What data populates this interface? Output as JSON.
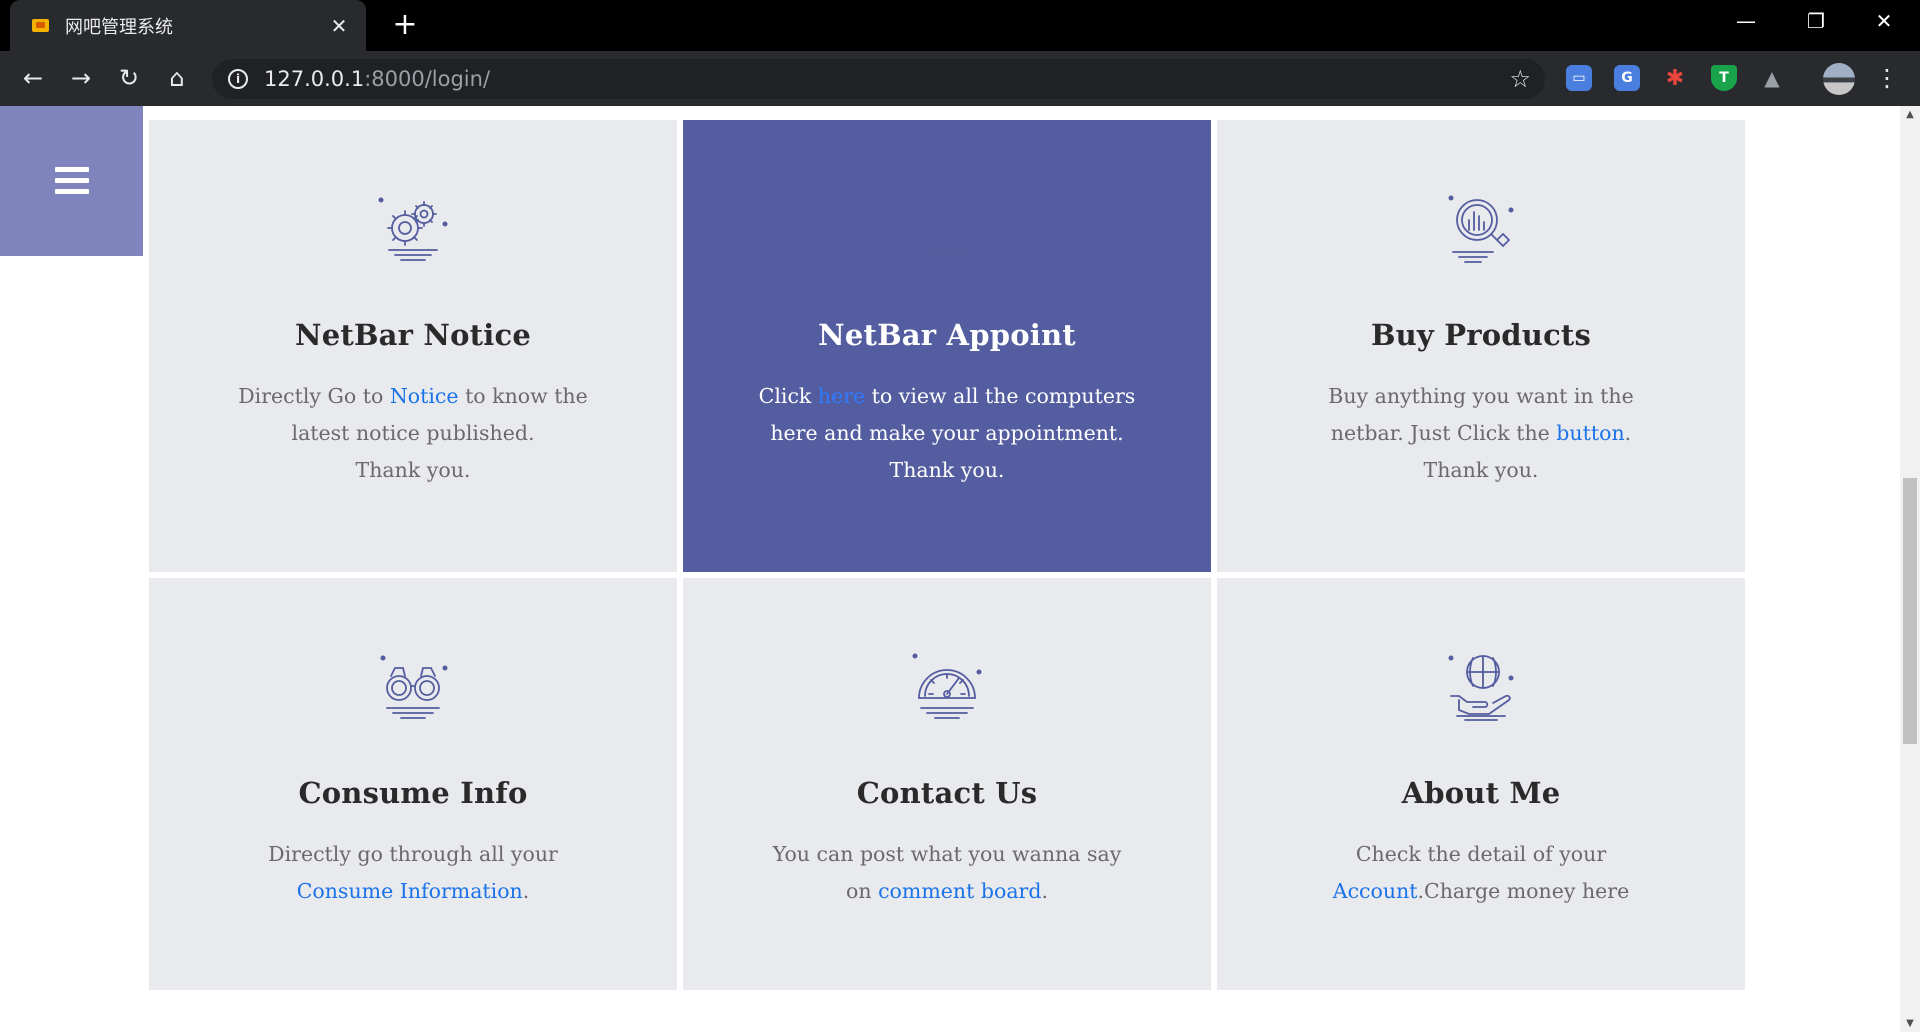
{
  "browser": {
    "tab_title": "网吧管理系统",
    "tab_close": "✕",
    "new_tab": "+",
    "url_host": "127.0.0.1",
    "url_path": ":8000/login/",
    "window_controls": {
      "minimize": "—",
      "restore": "❐",
      "close": "✕"
    },
    "nav": {
      "back": "←",
      "forward": "→",
      "reload": "↻",
      "home": "⌂"
    },
    "extensions": [
      {
        "name": "screen-reader-extension",
        "label": "▭",
        "color": "#4a7fe0"
      },
      {
        "name": "google-translate-extension",
        "label": "G",
        "color": "#4a7fe0"
      },
      {
        "name": "asterisk-extension",
        "label": "✱",
        "color": "#e8453c"
      },
      {
        "name": "tampermonkey-shield-extension",
        "label": "T",
        "color": "#1aa34a"
      },
      {
        "name": "google-drive-extension",
        "label": "▲",
        "color": "#9aa0a6"
      }
    ]
  },
  "page": {
    "menu_toggle_label": "menu",
    "accent_color": "#545d9f",
    "link_color": "#1a73e8",
    "cards": [
      {
        "icon": "gears-icon",
        "title": "NetBar Notice",
        "text_before": "Directly Go to ",
        "link_text": "Notice",
        "text_after": " to know the latest notice published.",
        "text_line3": "Thank you."
      },
      {
        "icon": "calendar-icon",
        "title": "NetBar Appoint",
        "text_before": "Click ",
        "link_text": "here",
        "text_after": " to view all the computers here and make your appointment.",
        "text_line3": "Thank you."
      },
      {
        "icon": "analytics-magnifier-icon",
        "title": "Buy Products",
        "text_before": "Buy anything you want in the netbar. Just Click the ",
        "link_text": "button",
        "text_after": ".",
        "text_line3": "Thank you."
      },
      {
        "icon": "binoculars-icon",
        "title": "Consume Info",
        "text_before": "Directly go through all your ",
        "link_text": "Consume Information",
        "text_after": ".",
        "text_line3": ""
      },
      {
        "icon": "speedometer-icon",
        "title": "Contact Us",
        "text_before": "You can post what you wanna say on ",
        "link_text": "comment board",
        "text_after": ".",
        "text_line3": ""
      },
      {
        "icon": "globe-hand-icon",
        "title": "About Me",
        "text_before": "Check the detail of your ",
        "link_text": "Account",
        "text_after": ".Charge money here",
        "text_line3": ""
      }
    ]
  }
}
